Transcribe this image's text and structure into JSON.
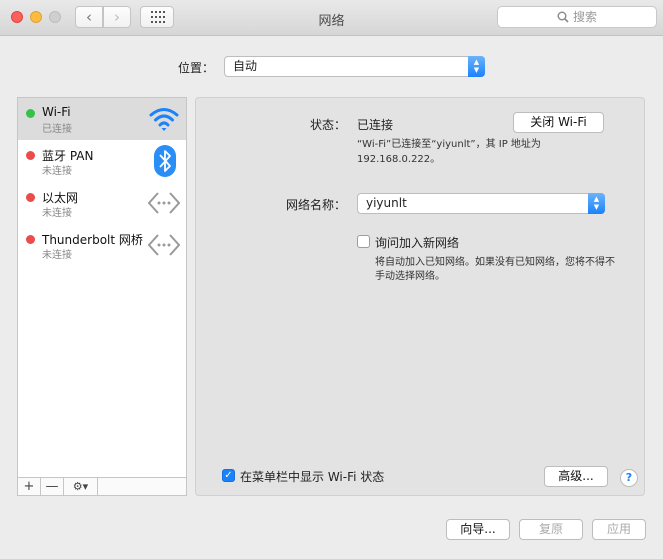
{
  "window": {
    "title": "网络"
  },
  "search": {
    "placeholder": "搜索"
  },
  "location": {
    "label": "位置：",
    "value": "自动"
  },
  "services": [
    {
      "name": "Wi-Fi",
      "status": "已连接",
      "color": "#35c24a",
      "icon": "wifi-icon"
    },
    {
      "name": "蓝牙 PAN",
      "status": "未连接",
      "color": "#ea4b4b",
      "icon": "bluetooth-icon"
    },
    {
      "name": "以太网",
      "status": "未连接",
      "color": "#ea4b4b",
      "icon": "ethernet-icon"
    },
    {
      "name": "Thunderbolt 网桥",
      "status": "未连接",
      "color": "#ea4b4b",
      "icon": "ethernet-icon"
    }
  ],
  "sidebar_tools": {
    "add": "+",
    "remove": "—"
  },
  "detail": {
    "status_label": "状态：",
    "status_value": "已连接",
    "wifi_off_button": "关闭 Wi-Fi",
    "status_description": "“Wi-Fi”已连接至“yiyunlt”，其 IP 地址为 192.168.0.222。",
    "network_name_label": "网络名称：",
    "network_name_value": "yiyunlt",
    "ask_join_label": "询问加入新网络",
    "ask_join_checked": false,
    "ask_join_description": "将自动加入已知网络。如果没有已知网络，您将不得不手动选择网络。",
    "show_menubar_label": "在菜单栏中显示 Wi-Fi 状态",
    "show_menubar_checked": true,
    "advanced_button": "高级...",
    "help_button": "?"
  },
  "bottom": {
    "assist": "向导...",
    "revert": "复原",
    "apply": "应用"
  },
  "colors": {
    "accent": "#1a82fb",
    "connected": "#35c24a",
    "disconnected": "#ea4b4b"
  }
}
